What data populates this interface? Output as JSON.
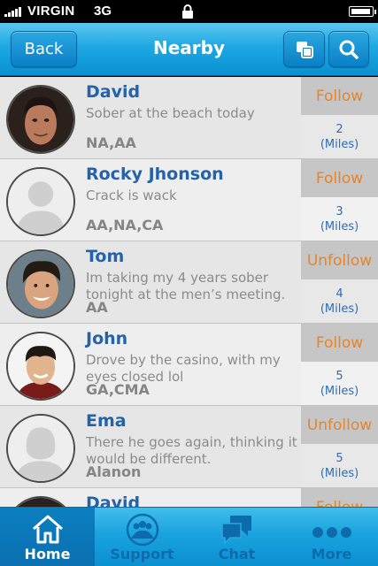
{
  "status_bar": {
    "carrier": "VIRGIN",
    "network": "3G",
    "icons": [
      "signal-icon",
      "lock-icon",
      "battery-icon"
    ]
  },
  "nav": {
    "back_label": "Back",
    "title": "Nearby",
    "icons": [
      "copy-icon",
      "search-icon"
    ]
  },
  "contacts": [
    {
      "name": "David",
      "status": "Sober at the beach today",
      "groups": "NA,AA",
      "action": "Follow",
      "distance": "2",
      "unit": "(Miles)",
      "avatar": "photo"
    },
    {
      "name": "Rocky Jhonson",
      "status": "Crack is wack",
      "groups": "AA,NA,CA",
      "action": "Follow",
      "distance": "3",
      "unit": "(Miles)",
      "avatar": "male-placeholder"
    },
    {
      "name": "Tom",
      "status": "Im taking my 4 years sober tonight at the men’s meeting.",
      "groups": "AA",
      "action": "Unfollow",
      "distance": "4",
      "unit": "(Miles)",
      "avatar": "photo"
    },
    {
      "name": "John",
      "status": "Drove by the casino, with my eyes closed lol",
      "groups": "GA,CMA",
      "action": "Follow",
      "distance": "5",
      "unit": "(Miles)",
      "avatar": "photo"
    },
    {
      "name": "Ema",
      "status": "There he goes again, thinking it would be different.",
      "groups": "Alanon",
      "action": "Unfollow",
      "distance": "5",
      "unit": "(Miles)",
      "avatar": "female-placeholder"
    },
    {
      "name": "David",
      "status": "",
      "groups": "",
      "action": "Follow",
      "distance": "",
      "unit": "",
      "avatar": "photo"
    }
  ],
  "tabs": [
    {
      "label": "Home",
      "icon": "home-icon",
      "active": true
    },
    {
      "label": "Support",
      "icon": "support-icon",
      "active": false
    },
    {
      "label": "Chat",
      "icon": "chat-icon",
      "active": false
    },
    {
      "label": "More",
      "icon": "more-icon",
      "active": false
    }
  ],
  "colors": {
    "nav_blue": "#1da8e3",
    "name_blue": "#2462aa",
    "follow_orange": "#e3852c"
  }
}
